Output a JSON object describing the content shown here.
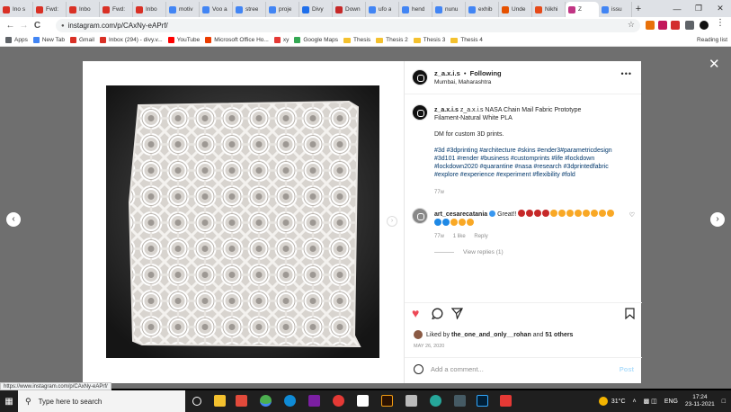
{
  "tabs": [
    {
      "label": "Ino s",
      "color": "#d93025"
    },
    {
      "label": "Fwd:",
      "color": "#d93025"
    },
    {
      "label": "Inbo",
      "color": "#d93025"
    },
    {
      "label": "Fwd:",
      "color": "#d93025"
    },
    {
      "label": "Inbo",
      "color": "#d93025"
    },
    {
      "label": "motiv",
      "color": "#4285f4"
    },
    {
      "label": "Voo a",
      "color": "#4285f4"
    },
    {
      "label": "stree",
      "color": "#4285f4"
    },
    {
      "label": "proje",
      "color": "#4285f4"
    },
    {
      "label": "Divy",
      "color": "#1f6feb"
    },
    {
      "label": "Down",
      "color": "#c62828"
    },
    {
      "label": "ufo a",
      "color": "#4285f4"
    },
    {
      "label": "hend",
      "color": "#4285f4"
    },
    {
      "label": "nunu",
      "color": "#4285f4"
    },
    {
      "label": "exhib",
      "color": "#4285f4"
    },
    {
      "label": "Unde",
      "color": "#e65100"
    },
    {
      "label": "Nikhi",
      "color": "#e64a19"
    },
    {
      "label": "Z",
      "color": "#c13584"
    },
    {
      "label": "issu",
      "color": "#4285f4"
    }
  ],
  "browser": {
    "url": "instagram.com/p/CAxNy-eAPrf/",
    "new_tab": "+",
    "minimize": "—",
    "maximize": "❐",
    "close": "✕",
    "back": "←",
    "forward": "→",
    "reload": "C",
    "lock": "🔒"
  },
  "bookmarks": [
    {
      "label": "Apps",
      "kind": "apps"
    },
    {
      "label": "New Tab",
      "kind": "globe"
    },
    {
      "label": "Gmail",
      "kind": "gmail"
    },
    {
      "label": "Inbox (294) - divy.v...",
      "kind": "gmail"
    },
    {
      "label": "YouTube",
      "kind": "youtube"
    },
    {
      "label": "Microsoft Office Ho...",
      "kind": "office"
    },
    {
      "label": "xy",
      "kind": "misc"
    },
    {
      "label": "Google Maps",
      "kind": "maps"
    },
    {
      "label": "Thesis",
      "kind": "folder"
    },
    {
      "label": "Thesis 2",
      "kind": "folder"
    },
    {
      "label": "Thesis 3",
      "kind": "folder"
    },
    {
      "label": "Thesis 4",
      "kind": "folder"
    }
  ],
  "reading_list": "Reading list",
  "post": {
    "username": "z_a.x.i.s",
    "follow": "Following",
    "separator": "•",
    "location": "Mumbai, Maharashtra",
    "caption_user": "z_a.x.i.s",
    "caption_line1": "z_a.x.i.s NASA Chain Mail Fabric Prototype",
    "caption_line2": "Filament-Natural White PLA",
    "caption_line3": "DM for custom 3D prints.",
    "hashtags": "#3d #3dprinting #architecture #skins #ender3#parametricdesign #3d101 #render #business #customprints #life #lockdown #lockdown2020 #quarantine #nasa #research #3dprintedfabric #explore #experience #experiment #flexibility #fold",
    "caption_time": "77w",
    "comment_user": "art_cesarecatania",
    "comment_text": "Great!!",
    "comment_time": "77w",
    "comment_likes": "1 like",
    "comment_reply": "Reply",
    "view_replies": "View replies (1)",
    "liked_by_prefix": "Liked by",
    "liked_by_user": "the_one_and_only__rohan",
    "liked_by_and": "and",
    "liked_by_count": "51 others",
    "date": "MAY 26, 2020",
    "add_comment_placeholder": "Add a comment...",
    "post_button": "Post"
  },
  "status_url": "https://www.instagram.com/p/CAxNy-eAPrf/",
  "taskbar": {
    "search_placeholder": "Type here to search",
    "temperature": "31°C",
    "language": "ENG",
    "time": "17:24",
    "date": "23-11-2021"
  },
  "colors": {
    "ig_blue": "#00376b",
    "heart": "#ed4956",
    "taskbar": "#1f1f1f"
  }
}
